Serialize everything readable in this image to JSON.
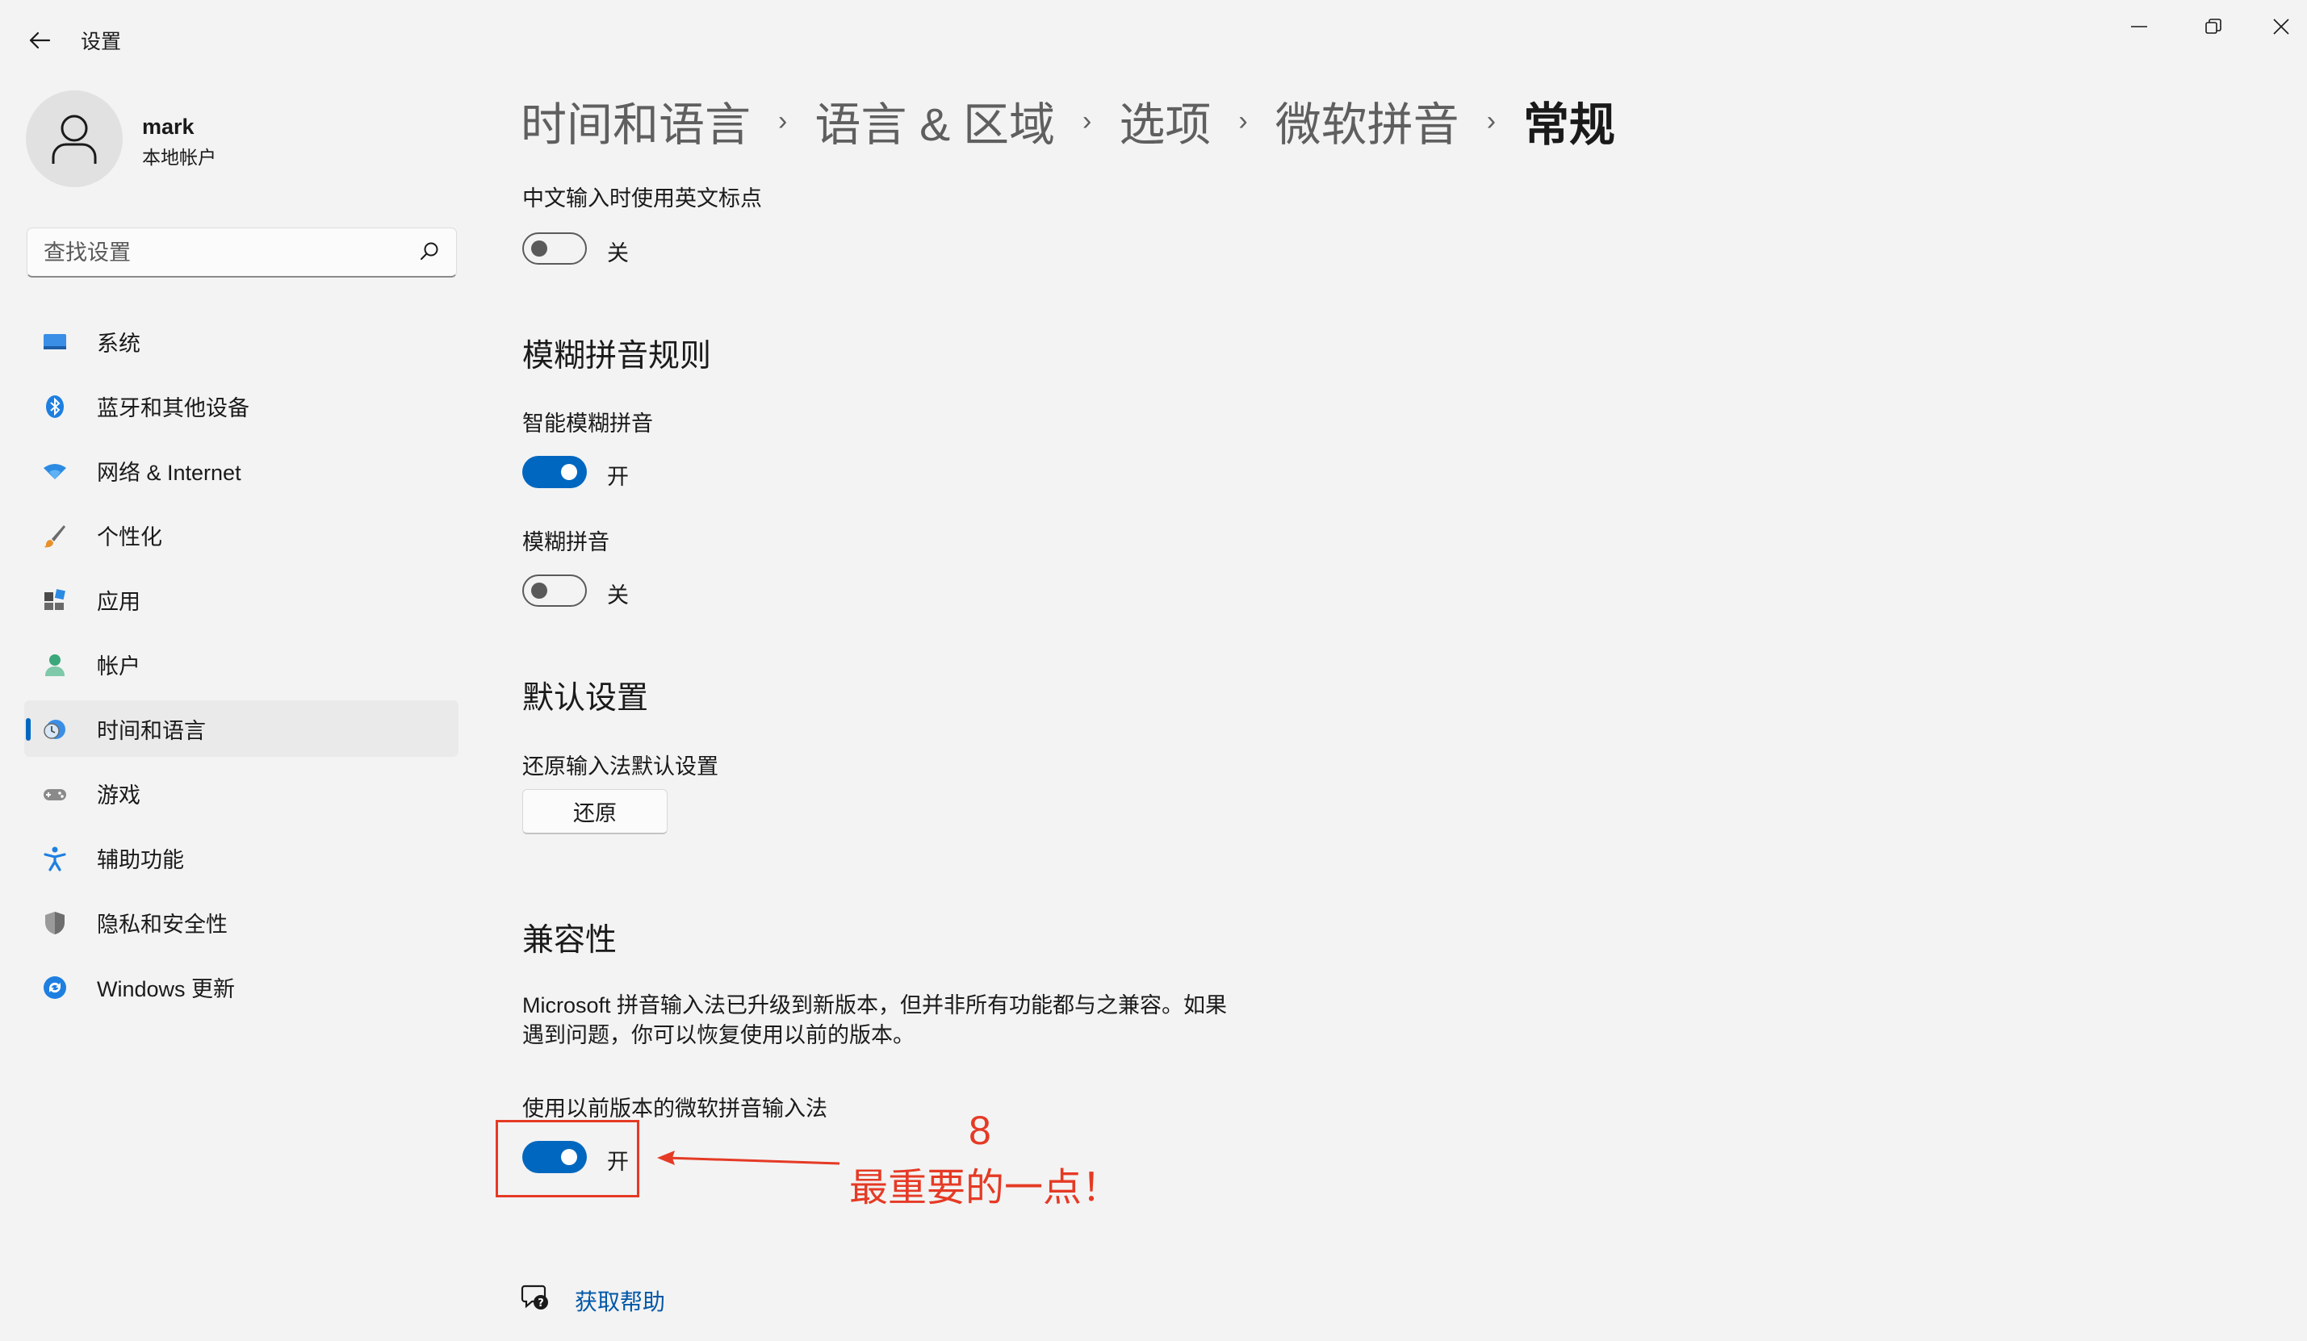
{
  "window": {
    "title": "设置"
  },
  "profile": {
    "name": "mark",
    "account_type": "本地帐户"
  },
  "search": {
    "placeholder": "查找设置"
  },
  "sidebar": {
    "items": [
      {
        "label": "系统",
        "icon": "monitor-icon"
      },
      {
        "label": "蓝牙和其他设备",
        "icon": "bluetooth-icon"
      },
      {
        "label": "网络 & Internet",
        "icon": "wifi-icon"
      },
      {
        "label": "个性化",
        "icon": "brush-icon"
      },
      {
        "label": "应用",
        "icon": "apps-icon"
      },
      {
        "label": "帐户",
        "icon": "person-icon"
      },
      {
        "label": "时间和语言",
        "icon": "globe-clock-icon",
        "active": true
      },
      {
        "label": "游戏",
        "icon": "gamepad-icon"
      },
      {
        "label": "辅助功能",
        "icon": "accessibility-icon"
      },
      {
        "label": "隐私和安全性",
        "icon": "shield-icon"
      },
      {
        "label": "Windows 更新",
        "icon": "update-icon"
      }
    ]
  },
  "breadcrumb": [
    "时间和语言",
    "语言 & 区域",
    "选项",
    "微软拼音",
    "常规"
  ],
  "content": {
    "english_punct": {
      "label": "中文输入时使用英文标点",
      "state": "关",
      "on": false
    },
    "fuzzy_section": {
      "title": "模糊拼音规则"
    },
    "smart_fuzzy": {
      "label": "智能模糊拼音",
      "state": "开",
      "on": true
    },
    "fuzzy": {
      "label": "模糊拼音",
      "state": "关",
      "on": false
    },
    "defaults_section": {
      "title": "默认设置"
    },
    "restore": {
      "label": "还原输入法默认设置",
      "button": "还原"
    },
    "compat_section": {
      "title": "兼容性"
    },
    "compat_desc": "Microsoft 拼音输入法已升级到新版本，但并非所有功能都与之兼容。如果遇到问题，你可以恢复使用以前的版本。",
    "previous_version": {
      "label": "使用以前版本的微软拼音输入法",
      "state": "开",
      "on": true
    },
    "help": {
      "label": "获取帮助"
    }
  },
  "annotation": {
    "number": "8",
    "text": "最重要的一点！",
    "color": "#e53a25"
  },
  "colors": {
    "accent": "#0067c0",
    "background": "#f3f3f3",
    "annotation": "#e53a25"
  }
}
